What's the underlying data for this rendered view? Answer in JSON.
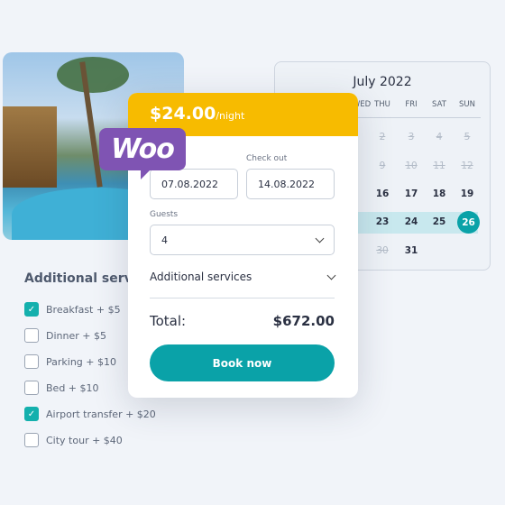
{
  "calendar": {
    "month": "July 2022",
    "headers": [
      "WED",
      "THU",
      "FRI",
      "SAT",
      "SUN"
    ],
    "rows": [
      [
        {
          "d": "2",
          "past": true
        },
        {
          "d": "3",
          "past": true
        },
        {
          "d": "4",
          "past": true
        },
        {
          "d": "5",
          "past": true
        }
      ],
      [
        {
          "d": "9",
          "past": true
        },
        {
          "d": "10",
          "past": true
        },
        {
          "d": "11",
          "past": true
        },
        {
          "d": "12",
          "past": true
        }
      ],
      [
        {
          "d": "16"
        },
        {
          "d": "17"
        },
        {
          "d": "18"
        },
        {
          "d": "19"
        }
      ],
      [
        {
          "d": "23"
        },
        {
          "d": "24"
        },
        {
          "d": "25"
        },
        {
          "d": "26",
          "selected": true
        }
      ],
      [
        {
          "d": "30",
          "past": true
        },
        {
          "d": "31"
        }
      ]
    ]
  },
  "services": {
    "title": "Additional services",
    "items": [
      {
        "label": "Breakfast + $5",
        "checked": true
      },
      {
        "label": "Dinner + $5",
        "checked": false
      },
      {
        "label": "Parking + $10",
        "checked": false
      },
      {
        "label": "Bed + $10",
        "checked": false
      },
      {
        "label": "Airport transfer + $20",
        "checked": true
      },
      {
        "label": "City tour + $40",
        "checked": false
      }
    ]
  },
  "booking": {
    "price": "$24.00",
    "per": "/night",
    "checkin_value": "07.08.2022",
    "checkout_label": "Check out",
    "checkout_value": "14.08.2022",
    "guests_label": "Guests",
    "guests_value": "4",
    "additional_label": "Additional services",
    "total_label": "Total:",
    "total_value": "$672.00",
    "book_label": "Book now"
  },
  "logo": "WOO",
  "colors": {
    "accent": "#0aa2a8",
    "header": "#f7bb00",
    "woo": "#7f54b3"
  }
}
